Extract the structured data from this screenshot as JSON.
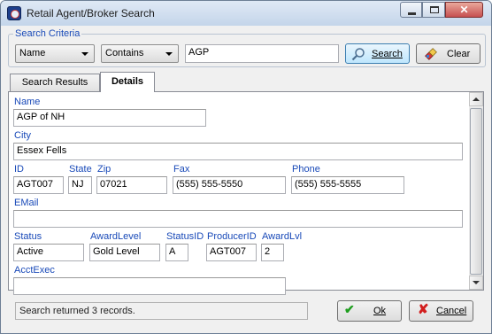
{
  "window": {
    "title": "Retail Agent/Broker Search",
    "close_glyph": "✕"
  },
  "search": {
    "group_label": "Search Criteria",
    "field_select": "Name",
    "operator_select": "Contains",
    "query_value": "AGP",
    "search_label": "Search",
    "clear_label": "Clear"
  },
  "tabs": [
    {
      "label": "Search Results",
      "active": false
    },
    {
      "label": "Details",
      "active": true
    }
  ],
  "details": {
    "name": {
      "label": "Name",
      "value": "AGP of NH"
    },
    "city": {
      "label": "City",
      "value": "Essex Fells"
    },
    "id": {
      "label": "ID",
      "value": "AGT007"
    },
    "state": {
      "label": "State",
      "value": "NJ"
    },
    "zip": {
      "label": "Zip",
      "value": "07021"
    },
    "fax": {
      "label": "Fax",
      "value": "(555) 555-5550"
    },
    "phone": {
      "label": "Phone",
      "value": "(555) 555-5555"
    },
    "email": {
      "label": "EMail",
      "value": ""
    },
    "status": {
      "label": "Status",
      "value": "Active"
    },
    "award_level": {
      "label": "AwardLevel",
      "value": "Gold Level"
    },
    "status_id": {
      "label": "StatusID",
      "value": "A"
    },
    "producer_id": {
      "label": "ProducerID",
      "value": "AGT007"
    },
    "award_lvl": {
      "label": "AwardLvl",
      "value": "2"
    },
    "acct_exec": {
      "label": "AcctExec",
      "value": ""
    }
  },
  "footer": {
    "status_text": "Search returned 3 records.",
    "ok_label": "Ok",
    "cancel_label": "Cancel"
  },
  "colors": {
    "label_blue": "#1849b8",
    "accent_close": "#c75050",
    "ok_green": "#1f9e1f",
    "cancel_red": "#d21e1e"
  },
  "icons": [
    "app-icon",
    "minimize-icon",
    "maximize-icon",
    "close-icon",
    "magnifier-icon",
    "eraser-icon",
    "check-icon",
    "x-icon",
    "scroll-up-arrow-icon",
    "scroll-down-arrow-icon"
  ]
}
